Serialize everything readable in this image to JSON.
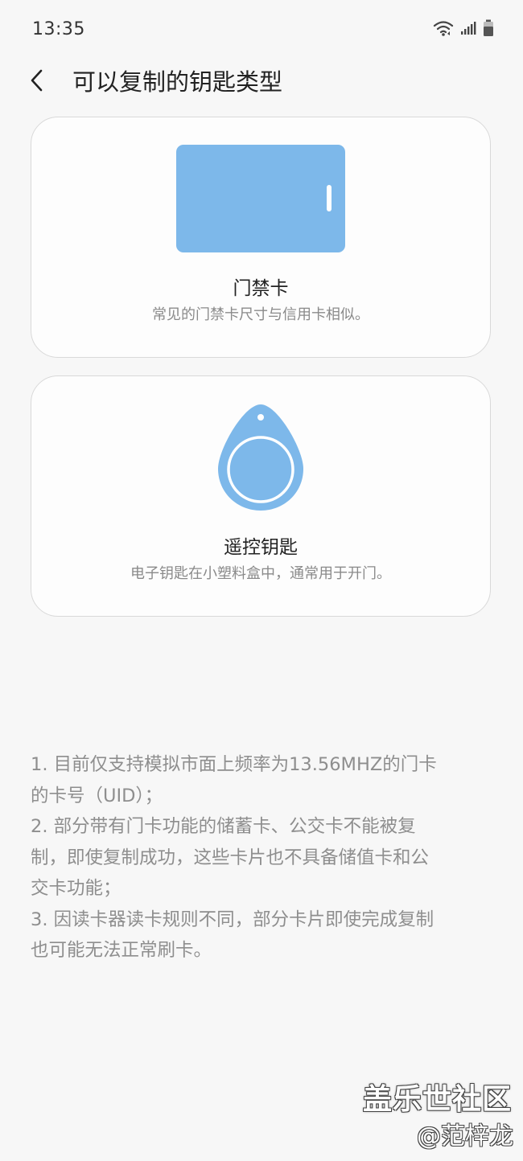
{
  "status_bar": {
    "time": "13:35",
    "icons": [
      "wifi-icon",
      "signal-icon",
      "battery-icon"
    ]
  },
  "header": {
    "back_icon": "chevron-left-icon",
    "title": "可以复制的钥匙类型"
  },
  "cards": [
    {
      "icon": "access-card-icon",
      "title": "门禁卡",
      "description": "常见的门禁卡尺寸与信用卡相似。"
    },
    {
      "icon": "key-fob-icon",
      "title": "遥控钥匙",
      "description": "电子钥匙在小塑料盒中，通常用于开门。"
    }
  ],
  "notes": [
    "1. 目前仅支持模拟市面上频率为13.56MHZ的门卡",
    "的卡号（UID）；",
    "2. 部分带有门卡功能的储蓄卡、公交卡不能被复",
    "制，即使复制成功，这些卡片也不具备储值卡和公",
    "交卡功能；",
    "3. 因读卡器读卡规则不同，部分卡片即使完成复制",
    "也可能无法正常刷卡。"
  ],
  "watermark": {
    "line1": "盖乐世社区",
    "line2": "@范梓龙"
  },
  "colors": {
    "background": "#f7f7f7",
    "card_background": "#fdfdfd",
    "card_border": "#d9d9d9",
    "illustration_blue": "#7db8ea",
    "description_gray": "#8a8a8a"
  }
}
